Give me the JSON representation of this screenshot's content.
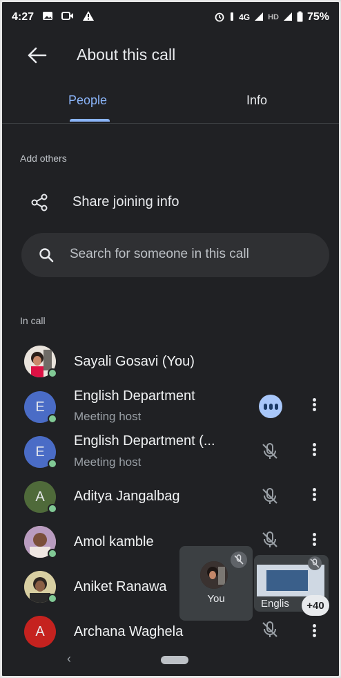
{
  "status_bar": {
    "time": "4:27",
    "network": "4G",
    "network2": "HD",
    "battery": "75%"
  },
  "header": {
    "title": "About this call"
  },
  "tabs": [
    {
      "label": "People",
      "selected": true
    },
    {
      "label": "Info",
      "selected": false
    }
  ],
  "add_others": {
    "section_label": "Add others",
    "share_label": "Share joining info"
  },
  "search": {
    "placeholder": "Search for someone in this call"
  },
  "in_call": {
    "section_label": "In call",
    "participants": [
      {
        "name": "Sayali Gosavi (You)",
        "avatar": "photo",
        "role": ""
      },
      {
        "name": "English Department",
        "avatar_letter": "E",
        "role": "Meeting host",
        "status": "speaking"
      },
      {
        "name": "English Department (...",
        "avatar_letter": "E",
        "role": "Meeting host",
        "status": "muted"
      },
      {
        "name": "Aditya Jangalbag",
        "avatar_letter": "A",
        "role": "",
        "status": "muted"
      },
      {
        "name": "Amol kamble",
        "avatar": "photo",
        "role": "",
        "status": "muted"
      },
      {
        "name": "Aniket Ranawa",
        "avatar": "photo",
        "role": "",
        "status": "muted"
      },
      {
        "name": "Archana Waghela",
        "avatar_letter": "A",
        "role": "",
        "status": "muted"
      }
    ]
  },
  "self_tile": {
    "label": "You"
  },
  "screen_tile": {
    "label": "Englis",
    "more_count": "+40"
  },
  "colors": {
    "background": "#202124",
    "accent": "#8ab4f8",
    "online_dot": "#81c995"
  }
}
